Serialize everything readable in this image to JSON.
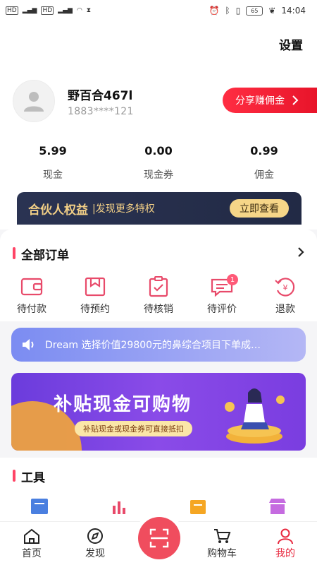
{
  "status_bar": {
    "time": "14:04",
    "battery": "65"
  },
  "header": {
    "settings_label": "设置"
  },
  "profile": {
    "name": "野百合467l",
    "phone": "1883****121",
    "share_button": "分享赚佣金"
  },
  "stats": [
    {
      "value": "5.99",
      "label": "现金"
    },
    {
      "value": "0.00",
      "label": "现金券"
    },
    {
      "value": "0.99",
      "label": "佣金"
    }
  ],
  "partner": {
    "title": "合伙人权益",
    "subtitle": "|发现更多特权",
    "button": "立即查看"
  },
  "orders": {
    "title": "全部订单",
    "items": [
      {
        "label": "待付款",
        "icon": "wallet-icon"
      },
      {
        "label": "待预约",
        "icon": "bookmark-box-icon"
      },
      {
        "label": "待核销",
        "icon": "clipboard-check-icon"
      },
      {
        "label": "待评价",
        "icon": "comment-icon",
        "badge": "1"
      },
      {
        "label": "退款",
        "icon": "refund-icon"
      }
    ]
  },
  "notice": {
    "text": "Dream 选择价值29800元的鼻综合项目下单成…"
  },
  "banner": {
    "title": "补贴现金可购物",
    "subtitle": "补贴现金或现金券可直接抵扣"
  },
  "tools": {
    "title": "工具"
  },
  "tabbar": [
    {
      "label": "首页",
      "icon": "home-icon"
    },
    {
      "label": "发现",
      "icon": "compass-icon"
    },
    {
      "label": "",
      "icon": "scan-icon"
    },
    {
      "label": "购物车",
      "icon": "cart-icon"
    },
    {
      "label": "我的",
      "icon": "user-icon",
      "active": true
    }
  ],
  "colors": {
    "accent": "#e8293f",
    "order_icon": "#e84a6a",
    "partner_bg": "#262e4b",
    "partner_gold": "#f2cf86"
  }
}
